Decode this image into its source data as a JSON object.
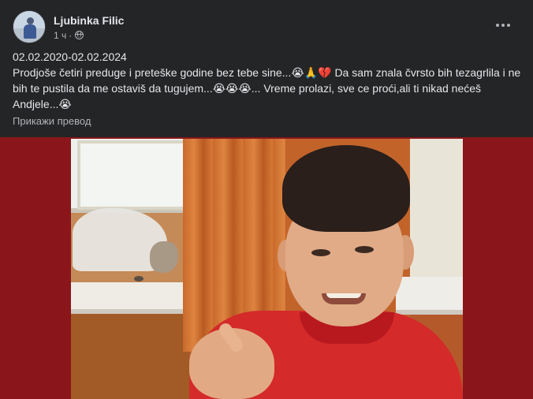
{
  "post": {
    "author": "Ljubinka Filic",
    "time": "1 ч",
    "separator": "·",
    "privacy_icon": "globe-icon",
    "more_icon": "more-horizontal-icon",
    "lines": [
      "02.02.2020-02.02.2024",
      "Prodjoše četiri preduge i preteške godine bez tebe sine...😭🙏💔 Da sam znala čvrsto bih tezagrlila i ne bih te pustila da me ostaviš da tugujem...😭😭😭... Vreme prolazi, sve ce proći,ali ti nikad nećeš Andjele...😭"
    ],
    "translate_label": "Прикажи превод",
    "photo": {
      "background_color": "#8a161b",
      "shirt_color": "#d42a2a"
    }
  }
}
